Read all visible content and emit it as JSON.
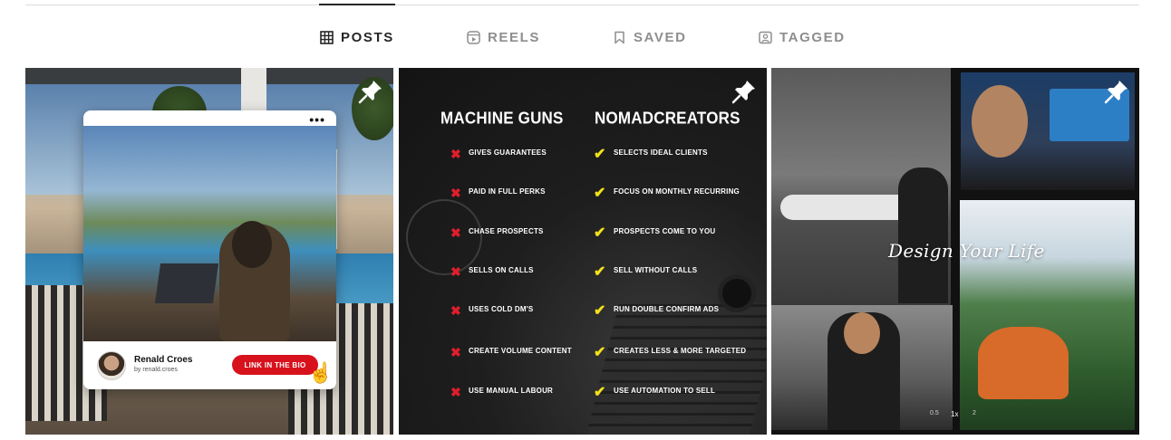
{
  "tabs": [
    {
      "label": "POSTS",
      "icon": "grid-icon",
      "active": true
    },
    {
      "label": "REELS",
      "icon": "reels-icon",
      "active": false
    },
    {
      "label": "SAVED",
      "icon": "bookmark-icon",
      "active": false
    },
    {
      "label": "TAGGED",
      "icon": "tagged-user-icon",
      "active": false
    }
  ],
  "posts": [
    {
      "pinned": true,
      "card": {
        "menu": "•••",
        "name": "Renald Croes",
        "by": "by renald.croes",
        "button": "LINK IN THE BIO"
      }
    },
    {
      "pinned": true,
      "left_title": "MACHINE GUNS",
      "right_title": "NOMADCREATORS",
      "left_items": [
        "GIVES GUARANTEES",
        "PAID IN FULL PERKS",
        "CHASE PROSPECTS",
        "SELLS ON CALLS",
        "USES COLD DM'S",
        "CREATE VOLUME CONTENT",
        "USE MANUAL LABOUR"
      ],
      "right_items": [
        "SELECTS IDEAL CLIENTS",
        "FOCUS ON MONTHLY RECURRING",
        "PROSPECTS COME TO YOU",
        "SELL WITHOUT CALLS",
        "RUN DOUBLE CONFIRM ADS",
        "CREATES LESS & MORE TARGETED",
        "USE AUTOMATION TO SELL"
      ],
      "colors": {
        "cross": "#e01e2b",
        "check": "#f2e21b"
      }
    },
    {
      "pinned": true,
      "overlay_text": "Design Your Life",
      "speed": [
        "0.5",
        "1x",
        "2"
      ]
    }
  ]
}
